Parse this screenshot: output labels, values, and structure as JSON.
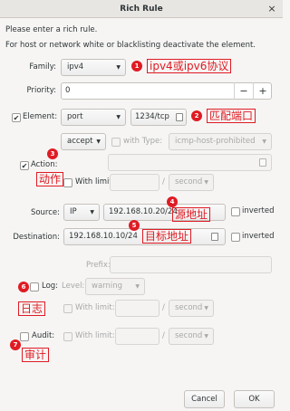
{
  "window": {
    "title": "Rich Rule",
    "close": "×"
  },
  "intro": {
    "line1": "Please enter a rich rule.",
    "line2": "For host or network white or blacklisting deactivate the element."
  },
  "family": {
    "label": "Family:",
    "value": "ipv4",
    "annotation": "ipv4或ipv6协议",
    "badge": "1"
  },
  "priority": {
    "label": "Priority:",
    "value": "0",
    "minus": "−",
    "plus": "+"
  },
  "element": {
    "checkbox": "✔",
    "label": "Element:",
    "type": "port",
    "value": "1234/tcp",
    "annotation": "匹配端口",
    "badge": "2"
  },
  "action": {
    "checkbox": "✔",
    "label": "Action:",
    "type": "accept",
    "with_type_label": "with Type:",
    "with_type_value": "icmp-host-prohibited",
    "with_limit_label": "With limit:",
    "slash": "/",
    "unit": "second",
    "annotation": "动作",
    "badge": "3"
  },
  "source": {
    "label": "Source:",
    "type": "IP",
    "value": "192.168.10.20/24",
    "inverted": "inverted",
    "annotation": "源地址",
    "badge": "4"
  },
  "destination": {
    "label": "Destination:",
    "value": "192.168.10.10/24",
    "inverted": "inverted",
    "annotation": "目标地址",
    "badge": "5"
  },
  "log": {
    "prefix_label": "Prefix:",
    "label": "Log:",
    "level_label": "Level:",
    "level_value": "warning",
    "with_limit_label": "With limit:",
    "slash": "/",
    "unit": "second",
    "annotation": "日志",
    "badge": "6"
  },
  "audit": {
    "label": "Audit:",
    "with_limit_label": "With limit:",
    "slash": "/",
    "unit": "second",
    "annotation": "审计",
    "badge": "7"
  },
  "footer": {
    "cancel": "Cancel",
    "ok": "OK"
  },
  "colors": {
    "annotation": "#e01b24",
    "background": "#f6f5f4"
  }
}
